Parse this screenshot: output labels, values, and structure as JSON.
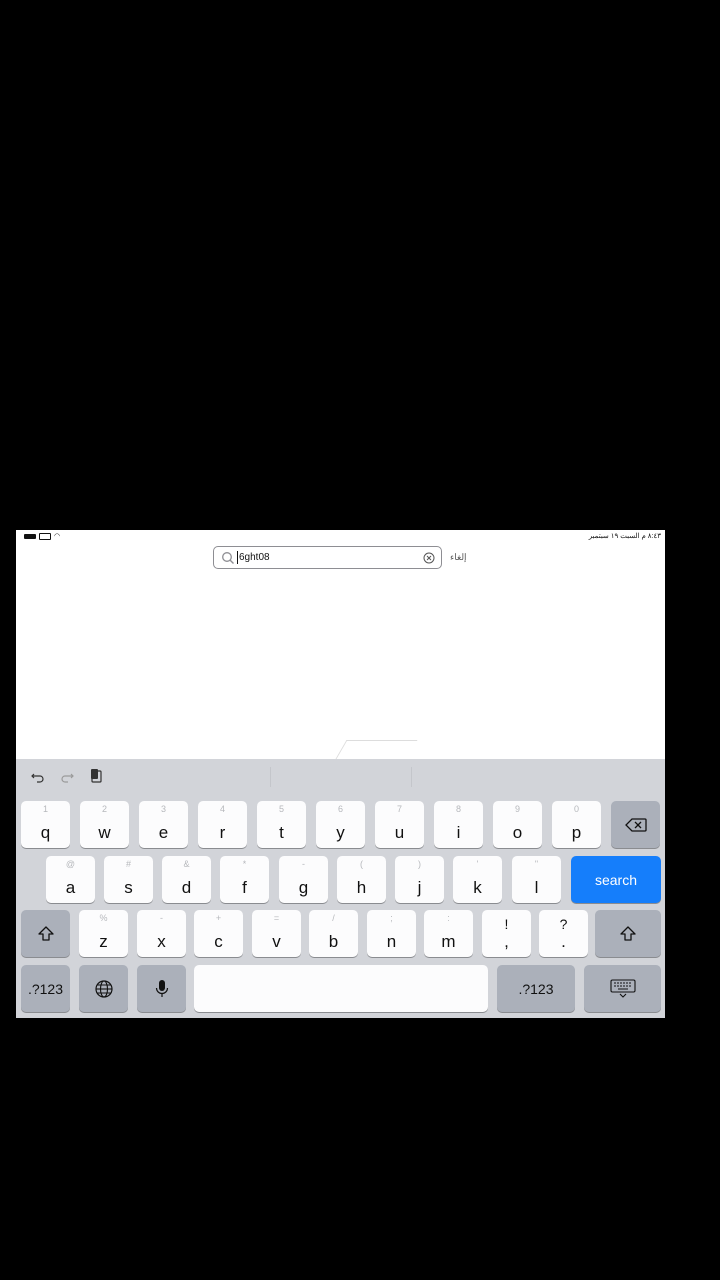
{
  "status_bar": {
    "time_date": "٨:٤٣ م  السبت ١٩ سبتمبر"
  },
  "search": {
    "value": "6ght08",
    "cancel_label": "إلغاء"
  },
  "keyboard": {
    "row1": [
      {
        "key": "q",
        "hint": "1"
      },
      {
        "key": "w",
        "hint": "2"
      },
      {
        "key": "e",
        "hint": "3"
      },
      {
        "key": "r",
        "hint": "4"
      },
      {
        "key": "t",
        "hint": "5"
      },
      {
        "key": "y",
        "hint": "6"
      },
      {
        "key": "u",
        "hint": "7"
      },
      {
        "key": "i",
        "hint": "8"
      },
      {
        "key": "o",
        "hint": "9"
      },
      {
        "key": "p",
        "hint": "0"
      }
    ],
    "row2": [
      {
        "key": "a",
        "hint": "@"
      },
      {
        "key": "s",
        "hint": "#"
      },
      {
        "key": "d",
        "hint": "&"
      },
      {
        "key": "f",
        "hint": "*"
      },
      {
        "key": "g",
        "hint": "-"
      },
      {
        "key": "h",
        "hint": "("
      },
      {
        "key": "j",
        "hint": ")"
      },
      {
        "key": "k",
        "hint": "'"
      },
      {
        "key": "l",
        "hint": "\""
      }
    ],
    "row3": [
      {
        "key": "z",
        "hint": "%"
      },
      {
        "key": "x",
        "hint": "-"
      },
      {
        "key": "c",
        "hint": "+"
      },
      {
        "key": "v",
        "hint": "="
      },
      {
        "key": "b",
        "hint": "/"
      },
      {
        "key": "n",
        "hint": ";"
      },
      {
        "key": "m",
        "hint": ":"
      }
    ],
    "row3_punct": [
      {
        "top": "!",
        "bottom": ","
      },
      {
        "top": "?",
        "bottom": "."
      }
    ],
    "search_label": "search",
    "numbers_left_label": ".?123",
    "numbers_right_label": ".?123"
  },
  "colors": {
    "accent": "#157efb",
    "keyboard_bg": "#d2d4d9"
  }
}
